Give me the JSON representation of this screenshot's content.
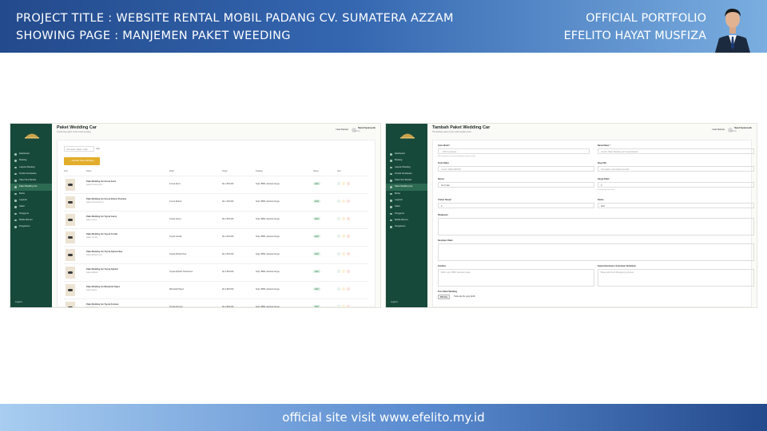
{
  "banner": {
    "project_title": "PROJECT TITLE : WEBSITE RENTAL MOBIL PADANG CV. SUMATERA AZZAM",
    "showing_page": "SHOWING PAGE : MANJEMEN PAKET WEEDING",
    "portfolio_label": "OFFICIAL PORTFOLIO",
    "author_name": "EFELITO HAYAT MUSFIZA"
  },
  "footer": {
    "text": "official site visit www.efelito.my.id"
  },
  "colors": {
    "sidebar": "#17493a",
    "accent_button": "#e2ad2a",
    "banner_dark": "#234a8c",
    "banner_light": "#7aaee0"
  },
  "sidebar": {
    "items": [
      "Dashboard",
      "Booking",
      "Laporan Booking",
      "Produk Kendaraan",
      "Paket Tour Bundel",
      "Paket Wedding Car",
      "Berita",
      "Layanan",
      "Galeri",
      "Pengguna",
      "Mobile Banner",
      "Pengaturan"
    ],
    "active": "Paket Wedding Car",
    "logout": "Logout"
  },
  "user": {
    "lang": "Lihat Website",
    "name": "Nandi Syamsudin",
    "role": "Admin"
  },
  "list_page": {
    "title": "Paket Wedding Car",
    "subtitle": "Kelola data paket rental mobil wedding",
    "search_placeholder": "Cari nama / paket / mobil",
    "search_button": "Cari",
    "add_button": "+ Tambah Paket Wedding",
    "columns": [
      "Foto",
      "Nama",
      "Mobil",
      "Harga",
      "Fasilitas",
      "Status",
      "Aksi"
    ],
    "rows": [
      {
        "name": "Paket Wedding Car Innova Zenix",
        "slug": "paket-innova-zenix",
        "car": "Innova Zenix",
        "price": "Rp 1.500.000",
        "facility": "Sopir, BBM, dekorasi bunga",
        "status": "Aktif"
      },
      {
        "name": "Paket Wedding Car Innova Reborn Premium",
        "slug": "paket-innova-reborn",
        "car": "Innova Reborn",
        "price": "Rp 1.200.000",
        "facility": "Sopir, BBM, dekorasi bunga",
        "status": "Aktif"
      },
      {
        "name": "Paket Wedding Car Toyota Camry",
        "slug": "paket-camry",
        "car": "Toyota Camry",
        "price": "Rp 2.500.000",
        "facility": "Sopir, BBM, dekorasi bunga",
        "status": "Aktif"
      },
      {
        "name": "Paket Wedding Car Toyota Corolla",
        "slug": "paket-corolla",
        "car": "Toyota Corolla",
        "price": "Rp 2.000.000",
        "facility": "Sopir, BBM, dekorasi bunga",
        "status": "Aktif"
      },
      {
        "name": "Paket Wedding Car Toyota Alphard New",
        "slug": "paket-alphard-new",
        "car": "Toyota Alphard New",
        "price": "Rp 4.500.000",
        "facility": "Sopir, BBM, dekorasi bunga",
        "status": "Aktif"
      },
      {
        "name": "Paket Wedding Car Toyota Alphard",
        "slug": "paket-alphard",
        "car": "Toyota Alphard Transformer",
        "price": "Rp 3.500.000",
        "facility": "Sopir, BBM, dekorasi bunga",
        "status": "Aktif"
      },
      {
        "name": "Paket Wedding Car Mitsubishi Pajero",
        "slug": "paket-pajero",
        "car": "Mitsubishi Pajero",
        "price": "Rp 2.500.000",
        "facility": "Sopir, BBM, dekorasi bunga",
        "status": "Aktif"
      },
      {
        "name": "Paket Wedding Car Toyota Fortuner",
        "slug": "paket-fortuner",
        "car": "Toyota Fortuner",
        "price": "Rp 2.500.000",
        "facility": "Sopir, BBM, dekorasi bunga",
        "status": "Aktif"
      }
    ]
  },
  "form_page": {
    "title": "Tambah Paket Wedding Car",
    "subtitle": "Tambahkan paket rental mobil wedding baru",
    "car_label": "Jenis Mobil *",
    "car_placeholder": "-- Pilih Kendaraan --",
    "car_hint": "Pilih kendaraan dari produk kendaraan yang tersedia",
    "name_label": "Nama Paket *",
    "name_placeholder": "Contoh: Paket Wedding Car Toyota Alphard",
    "code_label": "Kode Paket",
    "code_placeholder": "Contoh: WED-ZENIX01",
    "slug_label": "Slug URL",
    "slug_placeholder": "Kosongkan untuk dibuat otomatis",
    "unit_label": "Durasi",
    "unit_value": "Per 8 Jam",
    "price_label": "Harga Paket",
    "price_value": "0",
    "price_hint": "Isi tanpa titik atau koma",
    "order_label": "Urutan Tampil",
    "order_value": "0",
    "status_label": "Status",
    "status_value": "Aktif",
    "summary_label": "Ringkasan",
    "desc_label": "Deskripsi Paket",
    "facility_label": "Fasilitas",
    "facility_placeholder": "Mobil, sopir, BBM, dekorasi bunga",
    "terms_label": "Syarat Ketentuan / Ketentuan Tambahan",
    "terms_placeholder": "Biaya parkir & tol ditanggung penyewa",
    "photo_label": "Foto Paket Wedding",
    "file_button": "Pilih File",
    "file_status": "Tidak ada file yang dipilih"
  }
}
